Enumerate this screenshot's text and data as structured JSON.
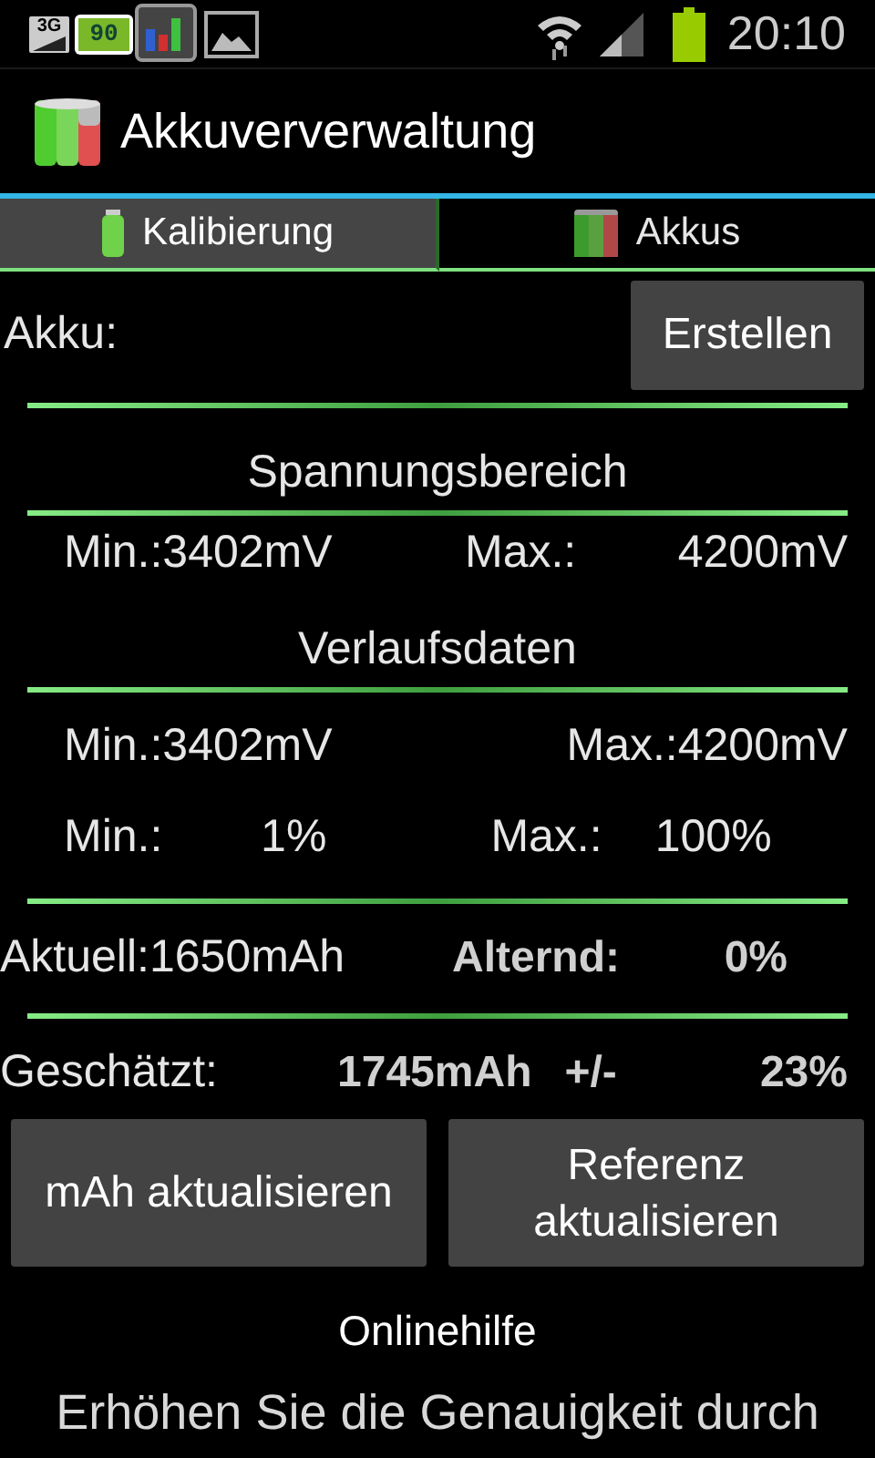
{
  "status_bar": {
    "network_type": "3G",
    "battery_widget": "90",
    "time": "20:10"
  },
  "app_bar": {
    "title": "Akkuververwaltung"
  },
  "tabs": [
    {
      "label": "Kalibierung",
      "selected": true
    },
    {
      "label": "Akkus",
      "selected": false
    }
  ],
  "akku": {
    "label": "Akku:",
    "create_button": "Erstellen"
  },
  "voltage_range": {
    "heading": "Spannungsbereich",
    "min": "Min.:3402mV",
    "max_label": "Max.:",
    "max_value": "4200mV"
  },
  "history": {
    "heading": "Verlaufsdaten",
    "voltage_min": "Min.:3402mV",
    "voltage_max": "Max.:4200mV",
    "percent_min_label": "Min.:",
    "percent_min_value": "1%",
    "percent_max_label": "Max.:",
    "percent_max_value": "100%"
  },
  "current": {
    "capacity": "Aktuell:1650mAh",
    "aging_label": "Alternd:",
    "aging_value": "0%"
  },
  "estimate": {
    "label": "Geschätzt:",
    "value": "1745mAh",
    "tolerance_label": "+/-",
    "tolerance_value": "23%"
  },
  "buttons": [
    "mAh aktualisieren",
    "Referenz aktualisieren"
  ],
  "help_link": "Onlinehilfe",
  "help_text": "Erhöhen Sie die Genauigkeit durch"
}
